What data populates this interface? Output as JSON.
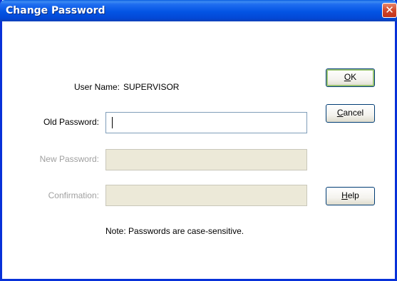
{
  "window": {
    "title": "Change Password",
    "close_glyph": "✕"
  },
  "form": {
    "user_name_label": "User Name:",
    "user_name_value": "SUPERVISOR",
    "old_password_label": "Old Password:",
    "old_password_value": "",
    "new_password_label": "New Password:",
    "confirmation_label": "Confirmation:",
    "note": "Note: Passwords are case-sensitive."
  },
  "buttons": {
    "ok_mnemonic": "O",
    "ok_rest": "K",
    "cancel_mnemonic": "C",
    "cancel_rest": "ancel",
    "help_mnemonic": "H",
    "help_rest": "elp"
  },
  "colors": {
    "titlebar": "#0354e4",
    "disabled_field": "#ece9d8",
    "disabled_text": "#a0a0a0"
  }
}
